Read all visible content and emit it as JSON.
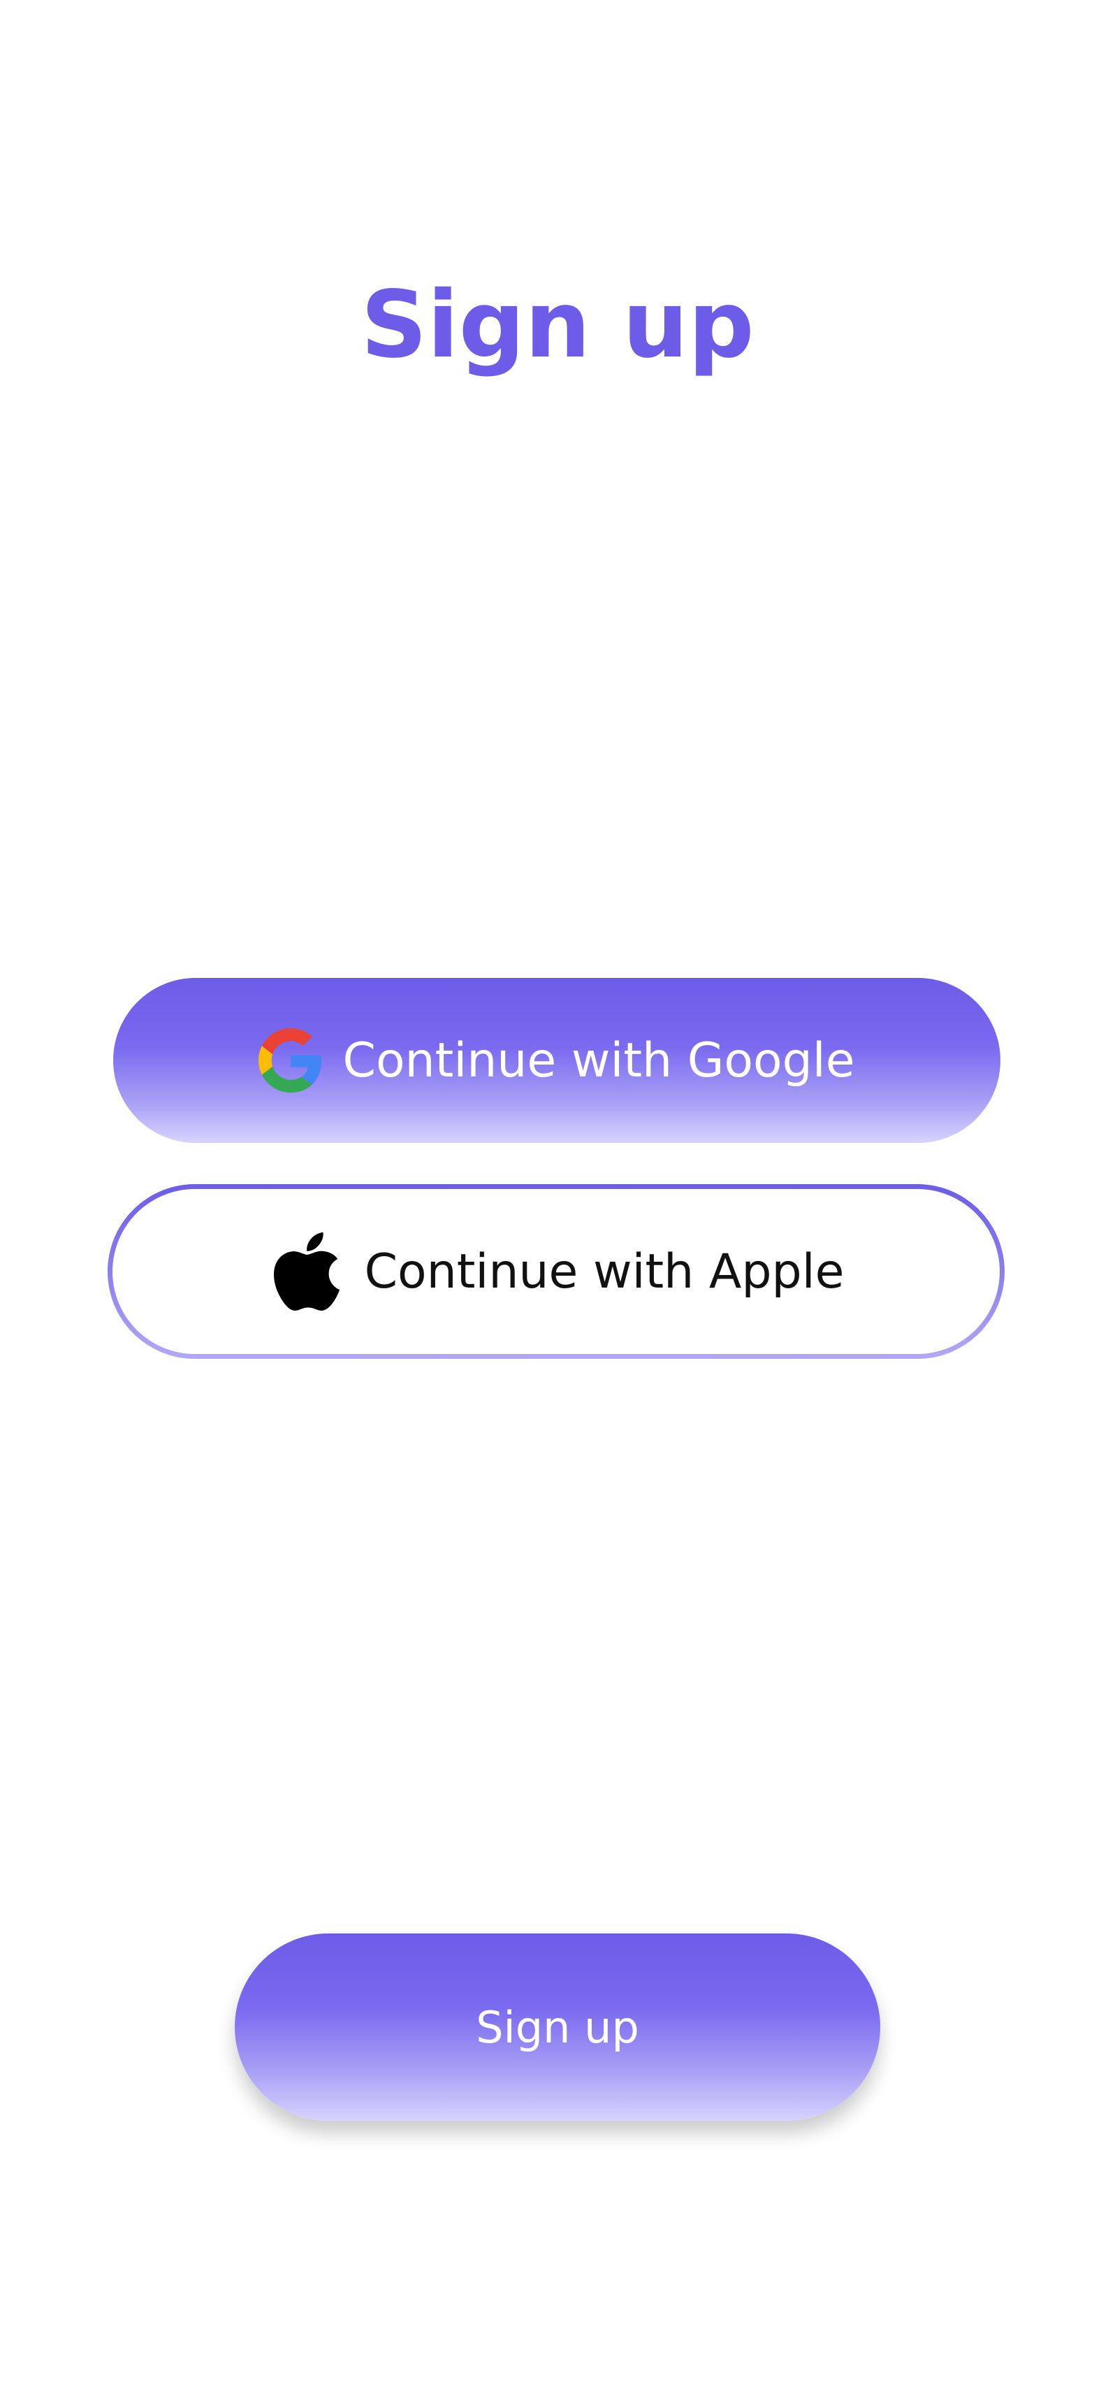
{
  "screen": {
    "title": "Sign up"
  },
  "auth": {
    "google_label": "Continue with Google",
    "apple_label": "Continue with Apple"
  },
  "actions": {
    "signup_label": "Sign up"
  },
  "icons": {
    "google": "google-logo-icon",
    "apple": "apple-logo-icon"
  },
  "colors": {
    "accent": "#6c5ce7",
    "accent_light": "#d7d3ff",
    "background": "#ffffff"
  }
}
